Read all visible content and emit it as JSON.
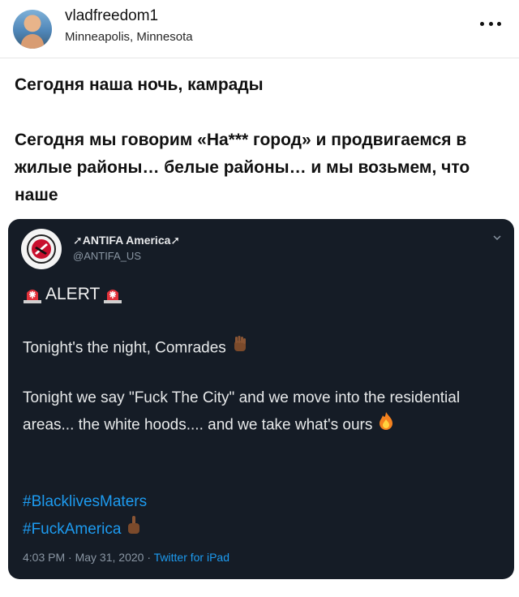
{
  "post": {
    "username": "vladfreedom1",
    "location": "Minneapolis, Minnesota",
    "caption": [
      "Сегодня наша ночь, камрады",
      "Сегодня мы говорим «На*** город» и продвигаемся в жилые районы… белые районы… и мы возьмем, что наше"
    ]
  },
  "tweet": {
    "display_name": "ANTIFA America",
    "handle": "@ANTIFA_US",
    "alert_label": "ALERT",
    "line1": "Tonight's the night, Comrades",
    "line2": "Tonight we say \"Fuck The City\" and we move into the residential areas... the white hoods.... and we take what's ours",
    "hashtags": [
      "#BlacklivesMaters",
      "#FuckAmerica"
    ],
    "time": "4:03 PM",
    "date": "May 31, 2020",
    "source": "Twitter for iPad"
  },
  "icons": {
    "more": "more-horizontal-icon",
    "chevron": "chevron-down-icon",
    "siren": "police-siren-icon",
    "fist": "raised-fist-icon",
    "fire": "fire-icon",
    "finger": "middle-finger-icon"
  },
  "colors": {
    "tweet_background": "#151c26",
    "hashtag_blue": "#1d9bf0",
    "muted": "#8a96a3"
  }
}
